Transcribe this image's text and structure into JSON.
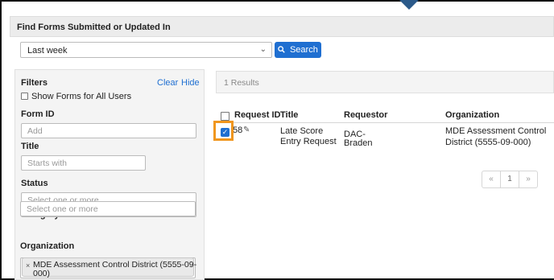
{
  "header": {
    "title": "Find Forms Submitted or Updated In"
  },
  "period": {
    "selected": "Last week",
    "chevron": "⌄"
  },
  "search": {
    "label": "Search"
  },
  "filters": {
    "title": "Filters",
    "clear": "Clear",
    "hide": "Hide",
    "show_all_users": "Show Forms for All Users",
    "form_id": {
      "label": "Form ID",
      "placeholder": "Add"
    },
    "title_field": {
      "label": "Title",
      "placeholder": "Starts with"
    },
    "status": {
      "label": "Status",
      "placeholder": "Select one or more"
    },
    "category": {
      "label": "Category",
      "placeholder": "Select one or more"
    },
    "organization": {
      "label": "Organization",
      "tag": "MDE Assessment Control District (5555-09-000)",
      "tag_remove": "×"
    }
  },
  "results": {
    "count_text": "1 Results",
    "columns": [
      "Request ID",
      "Title",
      "Requestor",
      "Organization"
    ],
    "rows": [
      {
        "id": "58",
        "title_line1": "Late Score",
        "title_line2": "Entry Request",
        "requestor_line1": "DAC-",
        "requestor_line2": "Braden",
        "org_line1": "MDE Assessment Control",
        "org_line2": "District (5555-09-000)",
        "checked": true
      }
    ],
    "pager": {
      "prev": "«",
      "page": "1",
      "next": "»"
    }
  }
}
